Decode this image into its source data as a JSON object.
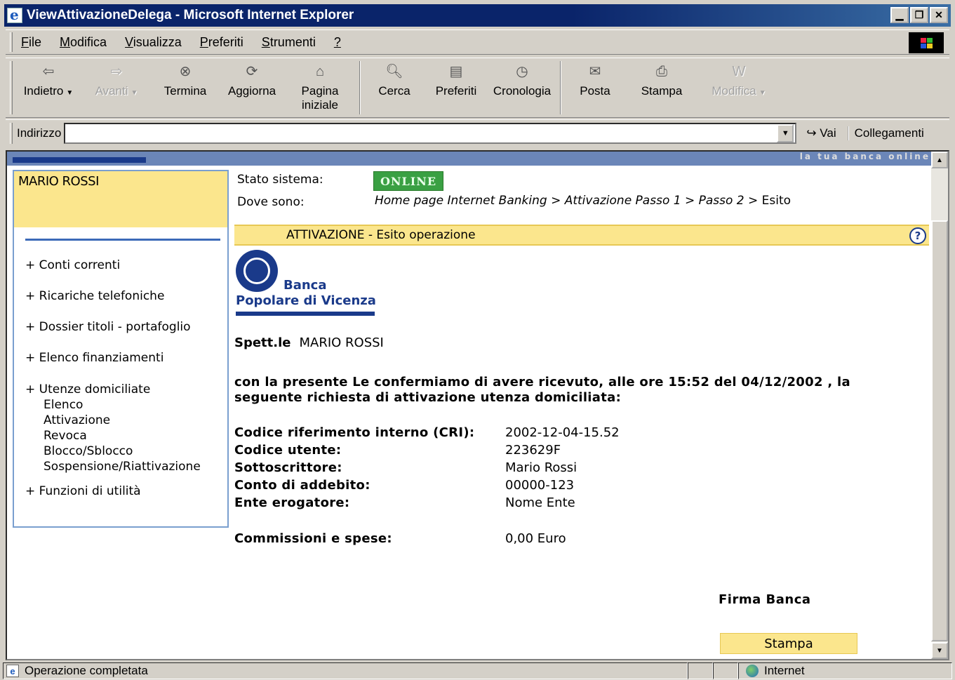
{
  "window": {
    "title": "ViewAttivazioneDelega - Microsoft Internet Explorer"
  },
  "menu": [
    {
      "pre": "",
      "acc": "F",
      "post": "ile"
    },
    {
      "pre": "",
      "acc": "M",
      "post": "odifica"
    },
    {
      "pre": "",
      "acc": "V",
      "post": "isualizza"
    },
    {
      "pre": "",
      "acc": "P",
      "post": "referiti"
    },
    {
      "pre": "",
      "acc": "S",
      "post": "trumenti"
    },
    {
      "pre": "",
      "acc": "?",
      "post": ""
    }
  ],
  "toolbar": {
    "back": "Indietro",
    "forward": "Avanti",
    "stop": "Termina",
    "refresh": "Aggiorna",
    "home_l1": "Pagina",
    "home_l2": "iniziale",
    "search": "Cerca",
    "favorites": "Preferiti",
    "history": "Cronologia",
    "mail": "Posta",
    "print": "Stampa",
    "edit": "Modifica"
  },
  "address": {
    "label": "Indirizzo",
    "value": "",
    "go": "Vai",
    "links": "Collegamenti"
  },
  "banner": {
    "text": "la tua banca online"
  },
  "sidebar": {
    "user": "MARIO ROSSI",
    "items": [
      "+ Conti correnti",
      "+ Ricariche telefoniche",
      "+ Dossier titoli - portafoglio",
      "+ Elenco finanziamenti"
    ],
    "utenze": {
      "label": "+ Utenze domiciliate",
      "sub": [
        "Elenco",
        "Attivazione",
        "Revoca",
        "Blocco/Sblocco",
        "Sospensione/Riattivazione"
      ]
    },
    "last": "+ Funzioni di utilità"
  },
  "main": {
    "stato_label": "Stato sistema:",
    "stato_value": "ONLINE",
    "dove_label": "Dove sono:",
    "breadcrumb_path": "Home page Internet Banking > Attivazione Passo 1 > Passo 2 > ",
    "breadcrumb_last": "Esito",
    "section_title": "ATTIVAZIONE - Esito operazione",
    "help": "?",
    "logo_line1": "Banca",
    "logo_line2": "Popolare di Vicenza",
    "spett_label": "Spett.le",
    "spett_name": "MARIO ROSSI",
    "confirm_text": "con la presente Le confermiamo di avere ricevuto, alle ore 15:52 del 04/12/2002 , la seguente richiesta di attivazione utenza domiciliata:",
    "details": [
      {
        "k": "Codice riferimento interno (CRI):",
        "v": "2002-12-04-15.52"
      },
      {
        "k": "Codice utente:",
        "v": "223629F"
      },
      {
        "k": "Sottoscrittore:",
        "v": "Mario Rossi"
      },
      {
        "k": "Conto di addebito:",
        "v": "00000-123"
      },
      {
        "k": "Ente erogatore:",
        "v": "Nome Ente"
      }
    ],
    "commissioni_label": "Commissioni e spese:",
    "commissioni_value": "0,00 Euro",
    "firma": "Firma Banca",
    "stampa": "Stampa"
  },
  "status": {
    "text": "Operazione completata",
    "zone": "Internet"
  },
  "colors": {
    "online": "#3aa043",
    "highlight": "#fbe68d",
    "brand": "#1a3a8a",
    "title": "#0a246a"
  }
}
